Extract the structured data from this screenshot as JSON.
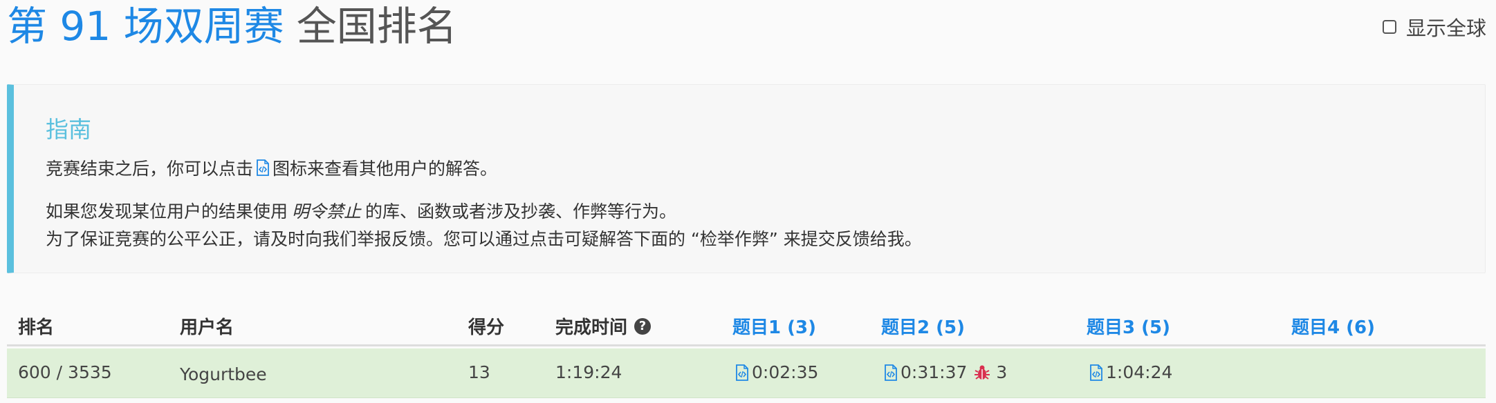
{
  "header": {
    "title_blue": "第 91 场双周赛",
    "title_dark": "全国排名",
    "global_toggle_label": "显示全球"
  },
  "guide": {
    "title": "指南",
    "line1_before": "竞赛结束之后，你可以点击",
    "line1_after": "图标来查看其他用户的解答。",
    "line2_before": "如果您发现某位用户的结果使用",
    "line2_italic": "明令禁止",
    "line2_after": "的库、函数或者涉及抄袭、作弊等行为。",
    "line3": "为了保证竞赛的公平公正，请及时向我们举报反馈。您可以通过点击可疑解答下面的 “检举作弊” 来提交反馈给我。"
  },
  "table": {
    "headers": {
      "rank": "排名",
      "username": "用户名",
      "score": "得分",
      "finish_time": "完成时间",
      "q1": "题目1 (3)",
      "q2": "题目2 (5)",
      "q3": "题目3 (5)",
      "q4": "题目4 (6)"
    },
    "rows": [
      {
        "rank": "600 / 3535",
        "username": "Yogurtbee",
        "score": "13",
        "finish_time": "1:19:24",
        "q1": "0:02:35",
        "q2": "0:31:37",
        "q2_penalty": "3",
        "q3": "1:04:24",
        "q4": ""
      }
    ]
  },
  "colors": {
    "accent": "#1e88e5",
    "info": "#5bc0de",
    "row_success": "#dff0d8",
    "bug": "#d9304f"
  }
}
